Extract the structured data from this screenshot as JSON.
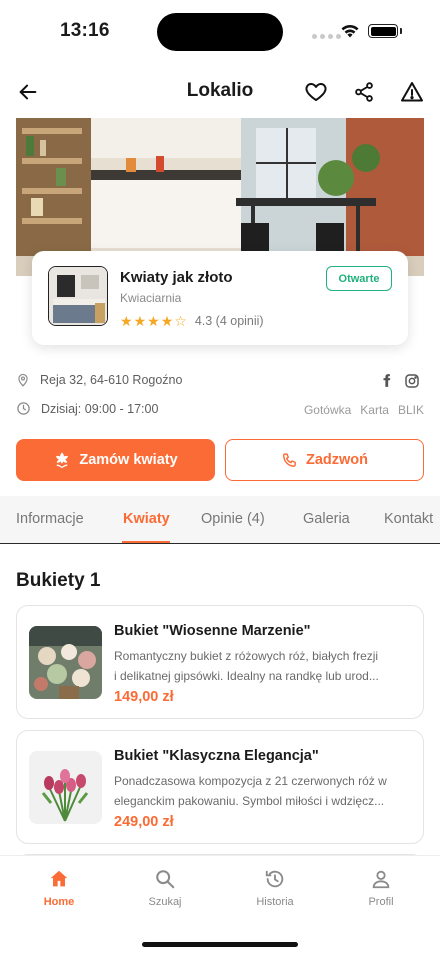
{
  "status_bar": {
    "time": "13:16"
  },
  "header": {
    "title": "Lokalio"
  },
  "business": {
    "name": "Kwiaty jak złoto",
    "category": "Kwiaciarnia",
    "rating": 4.3,
    "rating_text": "4.3 (4 opinii)",
    "status": "Otwarte",
    "address": "Reja 32, 64-610 Rogoźno",
    "hours": "Dzisiaj: 09:00 - 17:00",
    "payments": [
      "Gotówka",
      "Karta",
      "BLIK"
    ]
  },
  "actions": {
    "order_label": "Zamów kwiaty",
    "call_label": "Zadzwoń"
  },
  "tabs": [
    {
      "label": "Informacje"
    },
    {
      "label": "Kwiaty"
    },
    {
      "label": "Opinie (4)"
    },
    {
      "label": "Galeria"
    },
    {
      "label": "Kontakt"
    }
  ],
  "active_tab": "Kwiaty",
  "section": {
    "title": "Bukiety 1"
  },
  "products": [
    {
      "name": "Bukiet \"Wiosenne Marzenie\"",
      "desc_line1": "Romantyczny bukiet z różowych róż, białych frezji",
      "desc_line2": "i delikatnej gipsówki. Idealny na randkę lub urod...",
      "price": "149,00 zł"
    },
    {
      "name": "Bukiet \"Klasyczna Elegancja\"",
      "desc_line1": "Ponadczasowa kompozycja z 21 czerwonych róż w",
      "desc_line2": "eleganckim pakowaniu. Symbol miłości i wdzięcz...",
      "price": "249,00 zł"
    }
  ],
  "bottom_nav": [
    {
      "label": "Home",
      "icon": "home-icon"
    },
    {
      "label": "Szukaj",
      "icon": "search-icon"
    },
    {
      "label": "Historia",
      "icon": "history-icon"
    },
    {
      "label": "Profil",
      "icon": "profile-icon"
    }
  ],
  "colors": {
    "accent": "#fb6b35",
    "open_green": "#22b07d",
    "star": "#f5a623"
  }
}
